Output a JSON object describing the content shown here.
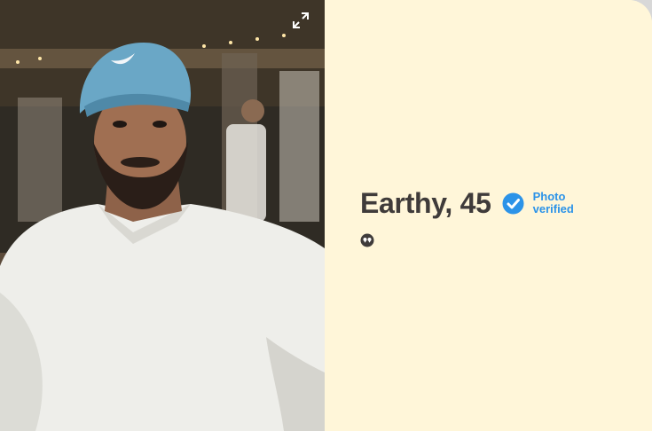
{
  "profile": {
    "name_age": "Earthy, 45",
    "verified_line1": "Photo",
    "verified_line2": "verified"
  },
  "icons": {
    "expand": "expand-icon",
    "verified": "verified-check-icon",
    "quote": "quote-icon"
  },
  "colors": {
    "card_background": "#fff6d9",
    "name_text": "#3f3b3a",
    "verified_blue": "#2c93e8"
  }
}
